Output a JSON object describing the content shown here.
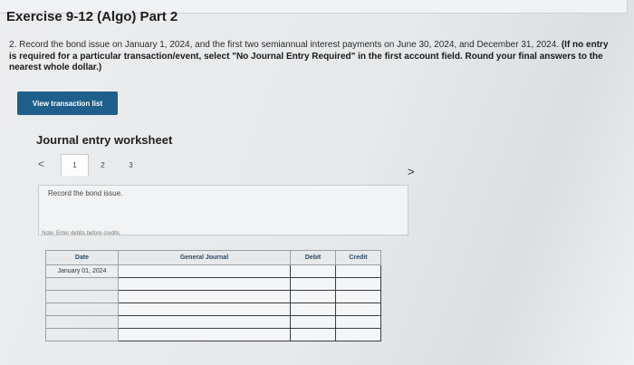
{
  "exercise": {
    "title": "Exercise 9-12 (Algo) Part 2",
    "instruction_plain": "2. Record the bond issue on January 1, 2024, and the first two semiannual interest payments on June 30, 2024, and December 31, 2024.",
    "instruction_bold": "(If no entry is required for a particular transaction/event, select \"No Journal Entry Required\" in the first account field. Round your final answers to the nearest whole dollar.)"
  },
  "toolbar": {
    "view_transactions_label": "View transaction list"
  },
  "worksheet": {
    "title": "Journal entry worksheet",
    "prev_label": "<",
    "next_label": ">",
    "tabs": [
      "1",
      "2",
      "3"
    ],
    "active_tab": "1",
    "description": "Record the bond issue.",
    "note": "Note: Enter debits before credits."
  },
  "journal": {
    "headers": {
      "date": "Date",
      "account": "General Journal",
      "debit": "Debit",
      "credit": "Credit"
    },
    "rows": [
      {
        "date": "January 01, 2024",
        "account": "",
        "debit": "",
        "credit": ""
      },
      {
        "date": "",
        "account": "",
        "debit": "",
        "credit": ""
      },
      {
        "date": "",
        "account": "",
        "debit": "",
        "credit": ""
      },
      {
        "date": "",
        "account": "",
        "debit": "",
        "credit": ""
      },
      {
        "date": "",
        "account": "",
        "debit": "",
        "credit": ""
      },
      {
        "date": "",
        "account": "",
        "debit": "",
        "credit": ""
      }
    ]
  },
  "colors": {
    "button": "#1f5f8b",
    "header_text": "#2a4a68"
  }
}
